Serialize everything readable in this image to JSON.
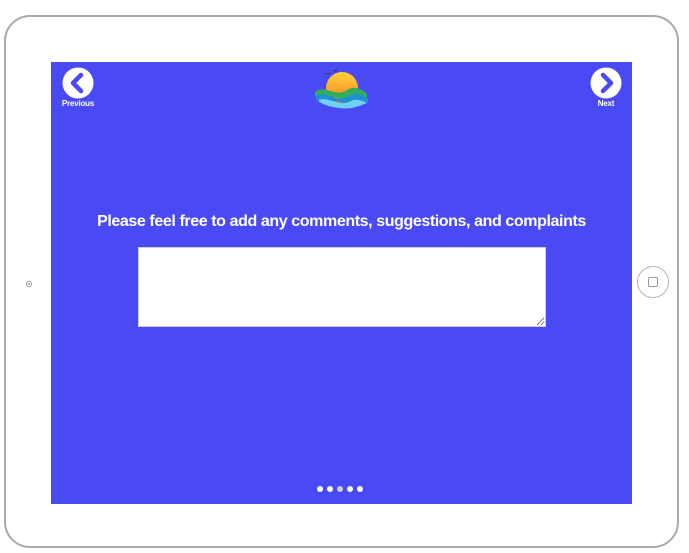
{
  "nav": {
    "previous_label": "Previous",
    "next_label": "Next"
  },
  "survey": {
    "prompt": "Please feel free to add any comments, suggestions, and complaints",
    "comment_value": "",
    "comment_placeholder": ""
  },
  "pagination": {
    "total_pages": 5,
    "current_page": 3
  },
  "colors": {
    "screen_background": "#4a4af4",
    "nav_icon": "#ffffff",
    "text": "#ffffff"
  },
  "icons": {
    "previous": "chevron-left-circle-icon",
    "next": "chevron-right-circle-icon",
    "logo": "sunset-waves-logo"
  }
}
